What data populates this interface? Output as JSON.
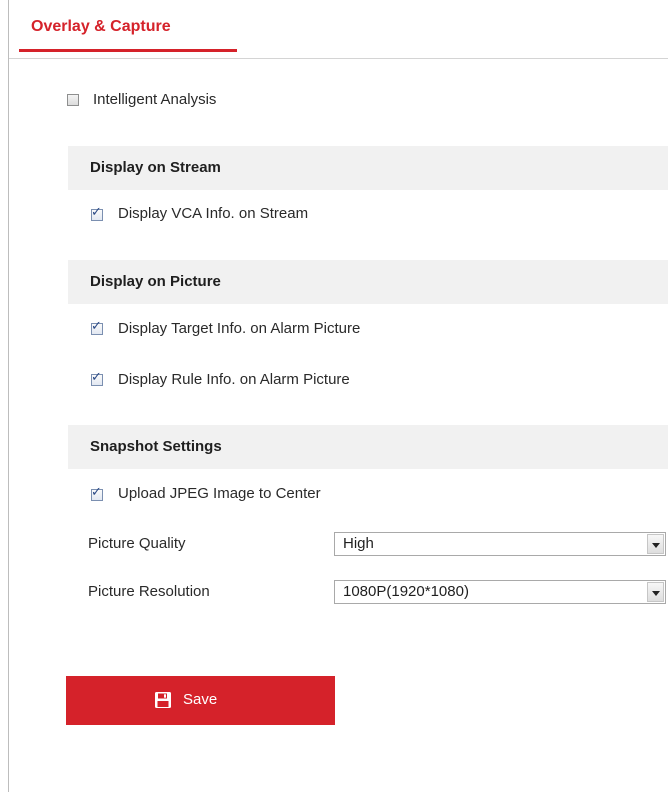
{
  "tab": {
    "label": "Overlay & Capture"
  },
  "intelligent_analysis": {
    "label": "Intelligent Analysis",
    "checked": false
  },
  "display_on_stream": {
    "title": "Display on Stream",
    "items": [
      {
        "label": "Display VCA Info. on Stream",
        "checked": true
      }
    ]
  },
  "display_on_picture": {
    "title": "Display on Picture",
    "items": [
      {
        "label": "Display Target Info. on Alarm Picture",
        "checked": true
      },
      {
        "label": "Display Rule Info. on Alarm Picture",
        "checked": true
      }
    ]
  },
  "snapshot_settings": {
    "title": "Snapshot Settings",
    "upload": {
      "label": "Upload JPEG Image to Center",
      "checked": true
    },
    "picture_quality": {
      "label": "Picture Quality",
      "value": "High"
    },
    "picture_resolution": {
      "label": "Picture Resolution",
      "value": "1080P(1920*1080)"
    }
  },
  "save": {
    "label": "Save",
    "icon": "floppy-disk-icon"
  },
  "colors": {
    "accent": "#d5222a",
    "section_bg": "#f1f1f1"
  }
}
